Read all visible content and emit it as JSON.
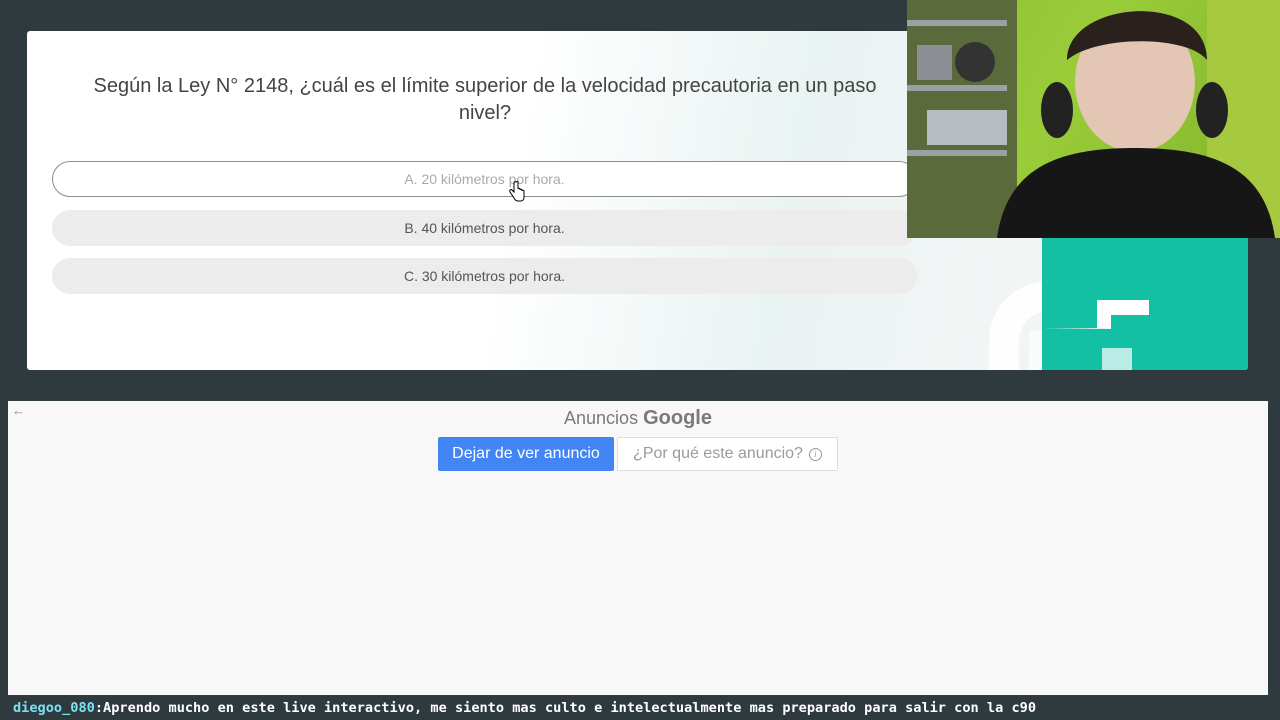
{
  "quiz": {
    "question": "Según la Ley N° 2148, ¿cuál es el límite superior de la velocidad precautoria en un paso nivel?",
    "answers": [
      "A. 20 kilómetros por hora.",
      "B. 40 kilómetros por hora.",
      "C. 30 kilómetros por hora."
    ]
  },
  "ad": {
    "back_icon": "arrow-left-icon",
    "title_prefix": "Anuncios",
    "title_brand": "Google",
    "stop_button": "Dejar de ver anuncio",
    "why_button": "¿Por qué este anuncio?",
    "info_icon": "i"
  },
  "chat": {
    "user": "diegoo_080",
    "separator": ":",
    "message": " Aprendo mucho en este live interactivo, me siento mas culto e intelectualmente mas preparado para salir con la c90"
  },
  "colors": {
    "background": "#2f3a3f",
    "brand_teal": "#13c0a3",
    "ad_blue": "#4285f4",
    "chat_user": "#7ee0f3"
  }
}
